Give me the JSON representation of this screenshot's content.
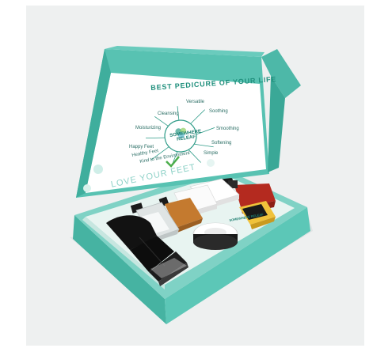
{
  "image": {
    "alt": "Pedicure kit in an open mint-green box",
    "colors": {
      "background": "#eef0f0",
      "box_teal": "#58c2b2",
      "box_teal_dark": "#3aa897",
      "box_teal_light": "#7fd2c5",
      "lid_inside": "#ffffff",
      "accent_green": "#2d9b87",
      "serum_amber": "#c47a2f",
      "lotion_red": "#b42a1f",
      "label_yellow": "#f0c23b",
      "file_black": "#101010"
    }
  },
  "lid": {
    "headline": "BEST PEDICURE OF YOUR LIFE",
    "wheel_words": [
      "Versatile",
      "Soothing",
      "Smoothing",
      "Softening",
      "Simple",
      "Kind to the Environment",
      "Healthy Feet",
      "Happy Feet",
      "Moisturizing",
      "Cleansing"
    ],
    "center_logo": "SOMEWHERE\nRELEAF",
    "slogan": "LOVE YOUR FEET"
  },
  "tray": {
    "logo_text": "SOMEWHERE RELEAF"
  }
}
